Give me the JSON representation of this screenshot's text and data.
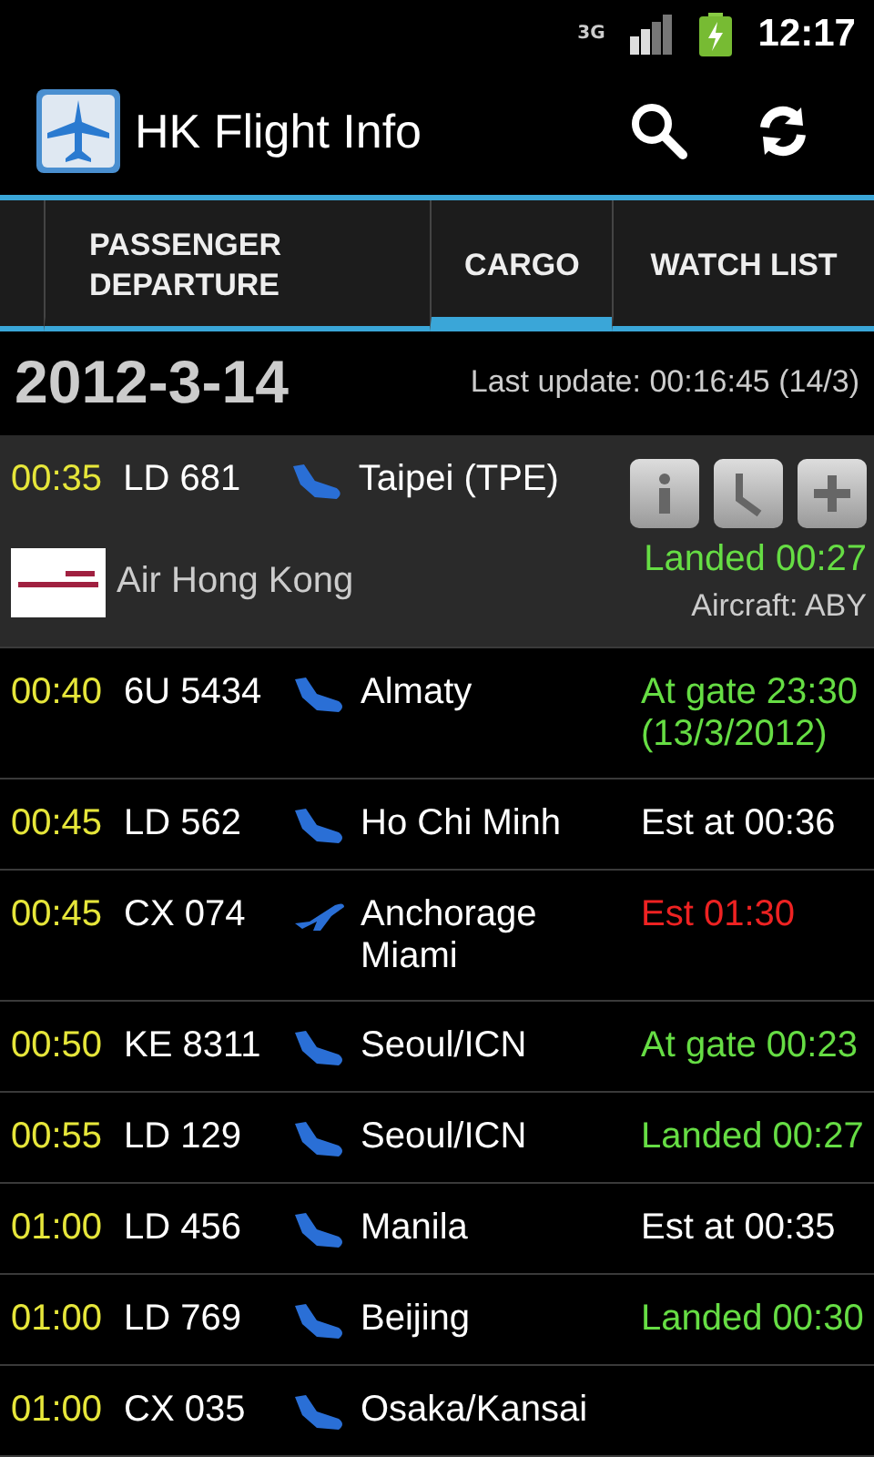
{
  "status_bar": {
    "network": "3G",
    "time": "12:17"
  },
  "app_bar": {
    "title": "HK Flight Info"
  },
  "tabs": [
    {
      "label": "PASSENGER DEPARTURE",
      "selected": false
    },
    {
      "label": "CARGO",
      "selected": true
    },
    {
      "label": "WATCH LIST",
      "selected": false
    }
  ],
  "date_header": {
    "date": "2012-3-14",
    "last_update": "Last update: 00:16:45 (14/3)"
  },
  "flights": [
    {
      "time": "00:35",
      "flight": "LD 681",
      "kind": "landing",
      "destination": "Taipei (TPE)",
      "status": "Landed 00:27",
      "color": "#66dd44",
      "expanded": true,
      "airline": "Air Hong Kong",
      "aircraft": "Aircraft: ABY"
    },
    {
      "time": "00:40",
      "flight": "6U 5434",
      "kind": "landing",
      "destination": "Almaty",
      "status": "At gate 23:30 (13/3/2012)",
      "color": "#66dd44",
      "expanded": false
    },
    {
      "time": "00:45",
      "flight": "LD 562",
      "kind": "landing",
      "destination": "Ho Chi Minh",
      "status": "Est at 00:36",
      "color": "#ffffff",
      "expanded": false
    },
    {
      "time": "00:45",
      "flight": "CX 074",
      "kind": "climbing",
      "destination": "Anchorage Miami",
      "status": "Est 01:30",
      "color": "#ee2222",
      "expanded": false
    },
    {
      "time": "00:50",
      "flight": "KE 8311",
      "kind": "landing",
      "destination": "Seoul/ICN",
      "status": "At gate 00:23",
      "color": "#66dd44",
      "expanded": false
    },
    {
      "time": "00:55",
      "flight": "LD 129",
      "kind": "landing",
      "destination": "Seoul/ICN",
      "status": "Landed 00:27",
      "color": "#66dd44",
      "expanded": false
    },
    {
      "time": "01:00",
      "flight": "LD 456",
      "kind": "landing",
      "destination": "Manila",
      "status": "Est at 00:35",
      "color": "#ffffff",
      "expanded": false
    },
    {
      "time": "01:00",
      "flight": "LD 769",
      "kind": "landing",
      "destination": "Beijing",
      "status": "Landed 00:30",
      "color": "#66dd44",
      "expanded": false
    },
    {
      "time": "01:00",
      "flight": "CX 035",
      "kind": "landing",
      "destination": "Osaka/Kansai",
      "expanded": false
    }
  ]
}
